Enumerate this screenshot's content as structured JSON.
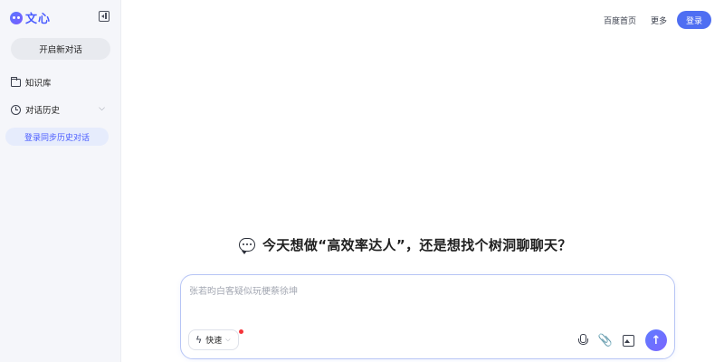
{
  "brand": {
    "name": "文心"
  },
  "sidebar": {
    "new_chat_label": "开启新对话",
    "knowledge_base_label": "知识库",
    "history_label": "对话历史",
    "login_sync_label": "登录同步历史对话"
  },
  "topnav": {
    "home_label": "百度首页",
    "more_label": "更多",
    "login_label": "登录"
  },
  "greeting": {
    "text": "今天想做“高效率达人”，还是想找个树洞聊聊天？"
  },
  "composer": {
    "placeholder": "张若昀白客疑似玩梗蔡徐坤",
    "value": "",
    "mode_label": "快速"
  },
  "icons": {
    "brand": "wenxin-logo-icon",
    "collapse": "sidebar-collapse-icon",
    "knowledge": "folder-icon",
    "history": "clock-icon",
    "greeting": "chat-bubble-icon",
    "mode": "bolt-icon",
    "mic": "microphone-icon",
    "attach": "paperclip-icon",
    "image": "image-icon",
    "send": "arrow-up-icon"
  },
  "colors": {
    "accent": "#4e6ef2",
    "brand": "#4a5cff",
    "sidebar_bg": "#f5f6fa",
    "notification_dot": "#f5343a"
  }
}
